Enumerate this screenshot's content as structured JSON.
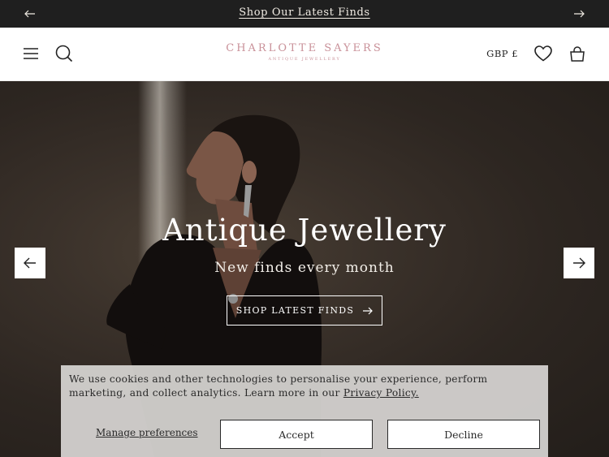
{
  "announcement": {
    "message": "Shop Our Latest Finds",
    "prev_icon": "arrow-left-icon",
    "next_icon": "arrow-right-icon"
  },
  "header": {
    "brand": "CHARLOTTE SAYERS",
    "tagline": "ANTIQUE JEWELLERY",
    "currency": "GBP £",
    "icons": [
      "menu-icon",
      "search-icon",
      "heart-icon",
      "bag-icon"
    ]
  },
  "hero": {
    "title": "Antique Jewellery",
    "subtitle": "New finds every month",
    "cta_label": "SHOP LATEST FINDS"
  },
  "cookie_banner": {
    "text": "We use cookies and other technologies to personalise your experience, perform marketing, and collect analytics. Learn more in our ",
    "policy_link": "Privacy Policy.",
    "manage_label": "Manage preferences",
    "accept_label": "Accept",
    "decline_label": "Decline"
  },
  "colors": {
    "announcement_bg": "#1f1f1f",
    "brand": "#c99199",
    "hero_bg": "#2d2621"
  }
}
